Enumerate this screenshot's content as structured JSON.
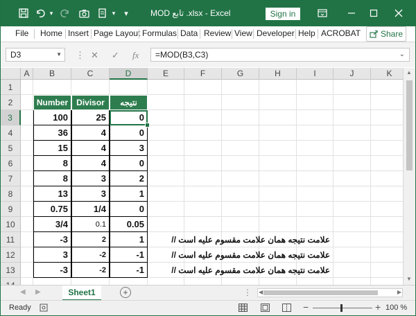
{
  "title_bar": {
    "title": "MOD تابع .xlsx  -  Excel",
    "sign_in_label": "Sign in",
    "icons": [
      "save-icon",
      "undo-icon",
      "redo-icon",
      "camera-icon",
      "form-icon",
      "customize-icon",
      "ribbon-display-icon",
      "minimize-icon",
      "restore-icon",
      "close-icon"
    ]
  },
  "menu": {
    "items": [
      "File",
      "Home",
      "Insert",
      "Page Layout",
      "Formulas",
      "Data",
      "Review",
      "View",
      "Developer",
      "Help",
      "ACROBAT"
    ],
    "share_label": "Share"
  },
  "formula_bar": {
    "name_box": "D3",
    "formula": "=MOD(B3,C3)",
    "fx_label": "fx"
  },
  "columns": [
    "A",
    "B",
    "C",
    "D",
    "E",
    "F",
    "G",
    "H",
    "I",
    "J",
    "K"
  ],
  "selected_column": "D",
  "rows": [
    "1",
    "2",
    "3",
    "4",
    "5",
    "6",
    "7",
    "8",
    "9",
    "10",
    "11",
    "12",
    "13",
    "14"
  ],
  "selected_row": "3",
  "table": {
    "headers": [
      "Number",
      "Divisor",
      "نتیجه"
    ],
    "rows": [
      [
        "100",
        "25",
        "0"
      ],
      [
        "36",
        "4",
        "0"
      ],
      [
        "15",
        "4",
        "3"
      ],
      [
        "8",
        "4",
        "0"
      ],
      [
        "8",
        "3",
        "2"
      ],
      [
        "13",
        "3",
        "1"
      ],
      [
        "0.75",
        "1/4",
        "0"
      ],
      [
        "3/4",
        "0.1",
        "0.05"
      ],
      [
        "-3",
        "2",
        "1"
      ],
      [
        "3",
        "-2",
        "-1"
      ],
      [
        "-3",
        "-2",
        "-1"
      ]
    ]
  },
  "notes": [
    "علامت نتیجه همان علامت مقسوم علیه است //",
    "علامت نتیجه همان علامت مقسوم علیه است //",
    "علامت نتیجه همان علامت مقسوم علیه است //"
  ],
  "sheet_tabs": [
    "Sheet1"
  ],
  "status": {
    "ready": "Ready",
    "zoom": "100 %"
  },
  "colors": {
    "excel_green": "#217346",
    "header_fill": "#2e7d4f"
  }
}
